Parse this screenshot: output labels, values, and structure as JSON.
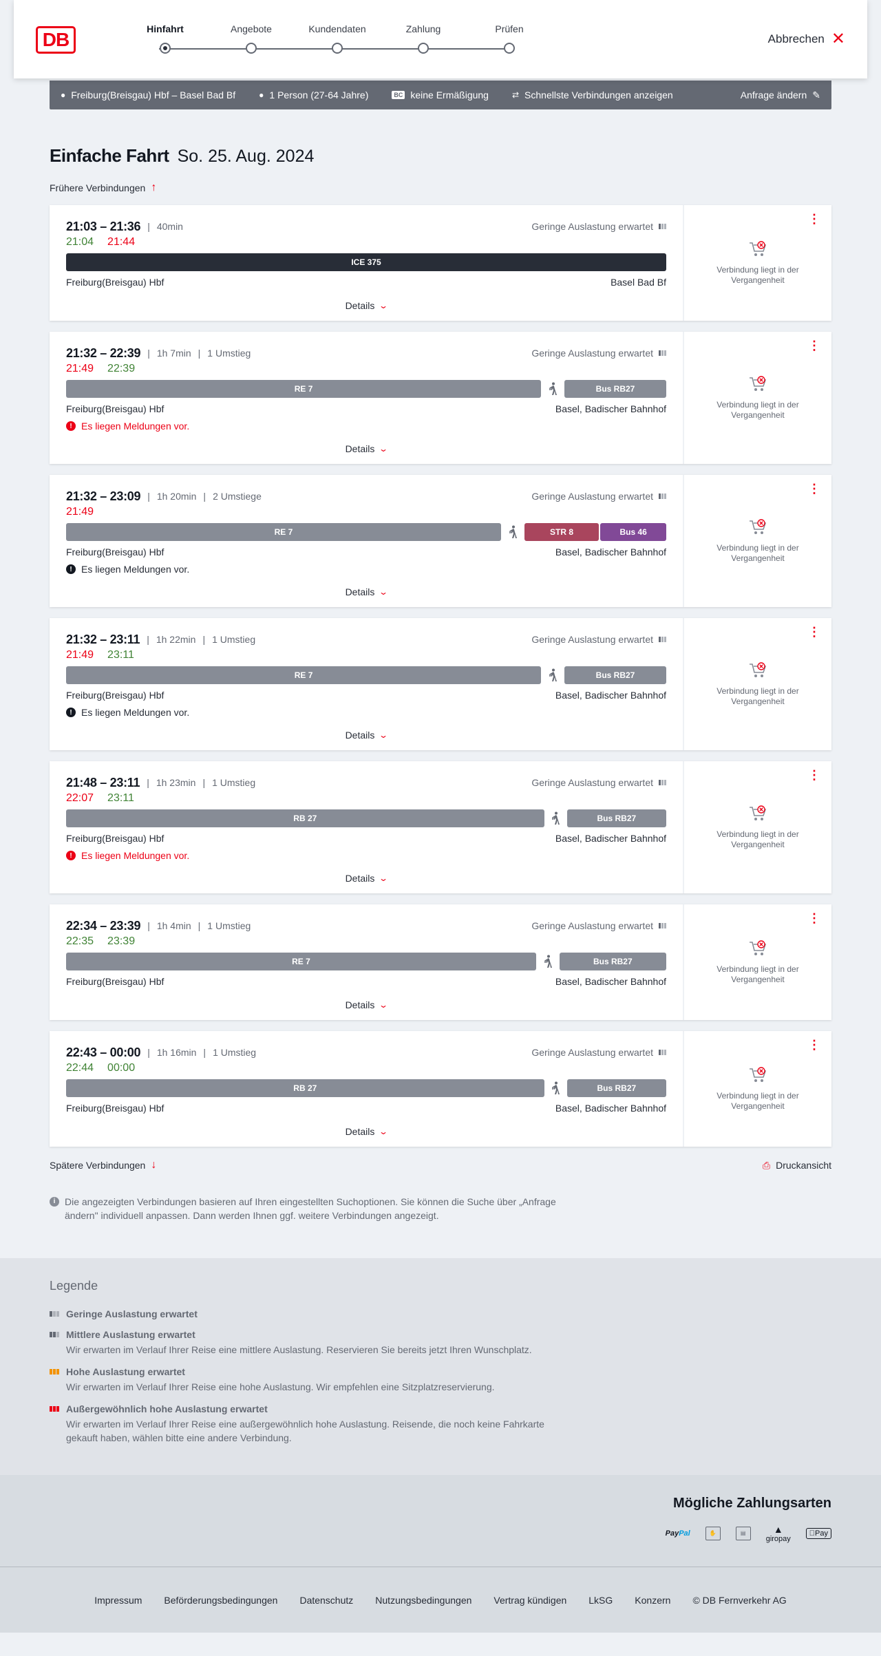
{
  "header": {
    "logo": "DB",
    "steps": [
      "Hinfahrt",
      "Angebote",
      "Kundendaten",
      "Zahlung",
      "Prüfen"
    ],
    "active_step": "Hinfahrt",
    "cancel_label": "Abbrechen"
  },
  "query": {
    "route": "Freiburg(Breisgau) Hbf – Basel Bad Bf",
    "travellers": "1 Person (27-64 Jahre)",
    "bc_badge": "BC",
    "discount": "keine Ermäßigung",
    "option": "Schnellste Verbindungen anzeigen",
    "edit_label": "Anfrage ändern"
  },
  "trip": {
    "type": "Einfache Fahrt",
    "date": "So. 25. Aug. 2024",
    "earlier_label": "Frühere Verbindungen",
    "later_label": "Spätere Verbindungen",
    "print_label": "Druckansicht",
    "hint": "Die angezeigten Verbindungen basieren auf Ihren eingestellten Suchoptionen. Sie können die Suche über „Anfrage ändern\" individuell anpassen. Dann werden Ihnen ggf. weitere Verbindungen angezeigt."
  },
  "labels": {
    "details": "Details",
    "load": "Geringe Auslastung erwartet",
    "past": "Verbindung liegt in der Vergangenheit"
  },
  "connections": [
    {
      "times": "21:03 – 21:36",
      "duration": "40min",
      "transfers": "",
      "rt_dep": "21:04",
      "rt_dep_color": "green",
      "rt_arr": "21:44",
      "rt_arr_color": "red",
      "segments": [
        {
          "label": "ICE 375",
          "kind": "ice",
          "share": 1
        }
      ],
      "from": "Freiburg(Breisgau) Hbf",
      "to": "Basel Bad Bf",
      "message": "",
      "message_type": ""
    },
    {
      "times": "21:32 – 22:39",
      "duration": "1h 7min",
      "transfers": "1 Umstieg",
      "rt_dep": "21:49",
      "rt_dep_color": "red",
      "rt_arr": "22:39",
      "rt_arr_color": "green",
      "segments": [
        {
          "label": "RE 7",
          "kind": "regio",
          "share": 0.795
        },
        {
          "label": "walk",
          "kind": "walk"
        },
        {
          "label": "Bus RB27",
          "kind": "regio",
          "share": 0.17
        }
      ],
      "from": "Freiburg(Breisgau) Hbf",
      "to": "Basel, Badischer Bahnhof",
      "message": "Es liegen Meldungen vor.",
      "message_type": "warn"
    },
    {
      "times": "21:32 – 23:09",
      "duration": "1h 20min",
      "transfers": "2 Umstiege",
      "rt_dep": "21:49",
      "rt_dep_color": "red",
      "rt_arr": "",
      "rt_arr_color": "",
      "segments": [
        {
          "label": "RE 7",
          "kind": "regio",
          "share": 0.725
        },
        {
          "label": "walk",
          "kind": "walk"
        },
        {
          "label": "STR 8",
          "kind": "str",
          "share": 0.125
        },
        {
          "label": "Bus 46",
          "kind": "bus46",
          "share": 0.11
        }
      ],
      "from": "Freiburg(Breisgau) Hbf",
      "to": "Basel, Badischer Bahnhof",
      "message": "Es liegen Meldungen vor.",
      "message_type": "info"
    },
    {
      "times": "21:32 – 23:11",
      "duration": "1h 22min",
      "transfers": "1 Umstieg",
      "rt_dep": "21:49",
      "rt_dep_color": "red",
      "rt_arr": "23:11",
      "rt_arr_color": "green",
      "segments": [
        {
          "label": "RE 7",
          "kind": "regio",
          "share": 0.795
        },
        {
          "label": "walk",
          "kind": "walk"
        },
        {
          "label": "Bus RB27",
          "kind": "regio",
          "share": 0.17
        }
      ],
      "from": "Freiburg(Breisgau) Hbf",
      "to": "Basel, Badischer Bahnhof",
      "message": "Es liegen Meldungen vor.",
      "message_type": "info"
    },
    {
      "times": "21:48 – 23:11",
      "duration": "1h 23min",
      "transfers": "1 Umstieg",
      "rt_dep": "22:07",
      "rt_dep_color": "red",
      "rt_arr": "23:11",
      "rt_arr_color": "green",
      "segments": [
        {
          "label": "RB 27",
          "kind": "regio",
          "share": 0.82
        },
        {
          "label": "walk",
          "kind": "walk"
        },
        {
          "label": "Bus RB27",
          "kind": "regio",
          "share": 0.17
        }
      ],
      "from": "Freiburg(Breisgau) Hbf",
      "to": "Basel, Badischer Bahnhof",
      "message": "Es liegen Meldungen vor.",
      "message_type": "warn"
    },
    {
      "times": "22:34 – 23:39",
      "duration": "1h 4min",
      "transfers": "1 Umstieg",
      "rt_dep": "22:35",
      "rt_dep_color": "green",
      "rt_arr": "23:39",
      "rt_arr_color": "green",
      "segments": [
        {
          "label": "RE 7",
          "kind": "regio",
          "share": 0.79
        },
        {
          "label": "walk",
          "kind": "walk"
        },
        {
          "label": "Bus RB27",
          "kind": "regio",
          "share": 0.18
        }
      ],
      "from": "Freiburg(Breisgau) Hbf",
      "to": "Basel, Badischer Bahnhof",
      "message": "",
      "message_type": ""
    },
    {
      "times": "22:43 – 00:00",
      "duration": "1h 16min",
      "transfers": "1 Umstieg",
      "rt_dep": "22:44",
      "rt_dep_color": "green",
      "rt_arr": "00:00",
      "rt_arr_color": "green",
      "segments": [
        {
          "label": "RB 27",
          "kind": "regio",
          "share": 0.82
        },
        {
          "label": "walk",
          "kind": "walk"
        },
        {
          "label": "Bus RB27",
          "kind": "regio",
          "share": 0.17
        }
      ],
      "from": "Freiburg(Breisgau) Hbf",
      "to": "Basel, Badischer Bahnhof",
      "message": "",
      "message_type": ""
    }
  ],
  "legend": {
    "title": "Legende",
    "items": [
      {
        "level": "low",
        "title": "Geringe Auslastung erwartet",
        "desc": ""
      },
      {
        "level": "mid",
        "title": "Mittlere Auslastung erwartet",
        "desc": "Wir erwarten im Verlauf Ihrer Reise eine mittlere Auslastung. Reservieren Sie bereits jetzt Ihren Wunschplatz."
      },
      {
        "level": "high",
        "title": "Hohe Auslastung erwartet",
        "desc": "Wir erwarten im Verlauf Ihrer Reise eine hohe Auslastung. Wir empfehlen eine Sitzplatzreservierung."
      },
      {
        "level": "vhigh",
        "title": "Außergewöhnlich hohe Auslastung erwartet",
        "desc": "Wir erwarten im Verlauf Ihrer Reise eine außergewöhnlich hohe Auslastung. Reisende, die noch keine Fahrkarte gekauft haben, wählen bitte eine andere Verbindung."
      }
    ]
  },
  "payment": {
    "title": "Mögliche Zahlungsarten",
    "paypal_a": "Pay",
    "paypal_b": "Pal",
    "giropay": "giropay",
    "applepay": "Pay"
  },
  "footer": {
    "links": [
      "Impressum",
      "Beförderungsbedingungen",
      "Datenschutz",
      "Nutzungsbedingungen",
      "Vertrag kündigen",
      "LkSG",
      "Konzern",
      "© DB Fernverkehr AG"
    ]
  },
  "colors": {
    "db_red": "#ec0016",
    "delay_red": "#ec0016",
    "ontime_green": "#408335",
    "ice_segment": "#282d37",
    "regio_segment": "#878c96",
    "tram_segment": "#a9455d",
    "bus46_segment": "#814997"
  },
  "icons": {
    "location": "map-pin-icon",
    "person": "person-icon",
    "swap": "arrows-icon",
    "edit": "pencil-icon",
    "close": "close-icon",
    "menu": "kebab-icon",
    "cart": "cart-disabled-icon",
    "walk": "walking-icon",
    "info": "info-icon",
    "print": "print-icon"
  }
}
